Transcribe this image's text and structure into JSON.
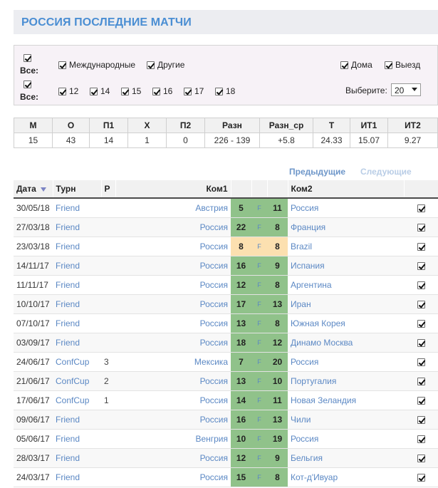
{
  "header": {
    "title": "РОССИЯ ПОСЛЕДНИЕ МАТЧИ"
  },
  "filters": {
    "all_label": "Все:",
    "type_options": [
      "Международные",
      "Другие"
    ],
    "age_options": [
      "12",
      "14",
      "15",
      "16",
      "17",
      "18"
    ],
    "venue_options": [
      "Дома",
      "Выезд"
    ],
    "select_label": "Выберите:",
    "select_value": "20"
  },
  "stats": {
    "headers": [
      "М",
      "О",
      "П1",
      "Х",
      "П2",
      "Разн",
      "Разн_ср",
      "Т",
      "ИТ1",
      "ИТ2"
    ],
    "values": [
      "15",
      "43",
      "14",
      "1",
      "0",
      "226 - 139",
      "+5.8",
      "24.33",
      "15.07",
      "9.27"
    ]
  },
  "pager": {
    "prev": "Предыдущие",
    "next": "Следующие"
  },
  "table": {
    "headers": {
      "date": "Дата",
      "tourn": "Турн",
      "round": "Р",
      "team1": "Ком1",
      "team2": "Ком2"
    },
    "rows": [
      {
        "date": "30/05/18",
        "tourn": "Friend",
        "round": "",
        "team1": "Австрия",
        "s1": "5",
        "f": "F",
        "s2": "11",
        "team2": "Россия",
        "result": "win"
      },
      {
        "date": "27/03/18",
        "tourn": "Friend",
        "round": "",
        "team1": "Россия",
        "s1": "22",
        "f": "F",
        "s2": "8",
        "team2": "Франция",
        "result": "win"
      },
      {
        "date": "23/03/18",
        "tourn": "Friend",
        "round": "",
        "team1": "Россия",
        "s1": "8",
        "f": "F",
        "s2": "8",
        "team2": "Brazil",
        "result": "draw"
      },
      {
        "date": "14/11/17",
        "tourn": "Friend",
        "round": "",
        "team1": "Россия",
        "s1": "16",
        "f": "F",
        "s2": "9",
        "team2": "Испания",
        "result": "win"
      },
      {
        "date": "11/11/17",
        "tourn": "Friend",
        "round": "",
        "team1": "Россия",
        "s1": "12",
        "f": "F",
        "s2": "8",
        "team2": "Аргентина",
        "result": "win"
      },
      {
        "date": "10/10/17",
        "tourn": "Friend",
        "round": "",
        "team1": "Россия",
        "s1": "17",
        "f": "F",
        "s2": "13",
        "team2": "Иран",
        "result": "win"
      },
      {
        "date": "07/10/17",
        "tourn": "Friend",
        "round": "",
        "team1": "Россия",
        "s1": "13",
        "f": "F",
        "s2": "8",
        "team2": "Южная Корея",
        "result": "win"
      },
      {
        "date": "03/09/17",
        "tourn": "Friend",
        "round": "",
        "team1": "Россия",
        "s1": "18",
        "f": "F",
        "s2": "12",
        "team2": "Динамо Москва",
        "result": "win"
      },
      {
        "date": "24/06/17",
        "tourn": "ConfCup",
        "round": "3",
        "team1": "Мексика",
        "s1": "7",
        "f": "F",
        "s2": "20",
        "team2": "Россия",
        "result": "win"
      },
      {
        "date": "21/06/17",
        "tourn": "ConfCup",
        "round": "2",
        "team1": "Россия",
        "s1": "13",
        "f": "F",
        "s2": "10",
        "team2": "Португалия",
        "result": "win"
      },
      {
        "date": "17/06/17",
        "tourn": "ConfCup",
        "round": "1",
        "team1": "Россия",
        "s1": "14",
        "f": "F",
        "s2": "11",
        "team2": "Новая Зеландия",
        "result": "win"
      },
      {
        "date": "09/06/17",
        "tourn": "Friend",
        "round": "",
        "team1": "Россия",
        "s1": "16",
        "f": "F",
        "s2": "13",
        "team2": "Чили",
        "result": "win"
      },
      {
        "date": "05/06/17",
        "tourn": "Friend",
        "round": "",
        "team1": "Венгрия",
        "s1": "10",
        "f": "F",
        "s2": "19",
        "team2": "Россия",
        "result": "win"
      },
      {
        "date": "28/03/17",
        "tourn": "Friend",
        "round": "",
        "team1": "Россия",
        "s1": "12",
        "f": "F",
        "s2": "9",
        "team2": "Бельгия",
        "result": "win"
      },
      {
        "date": "24/03/17",
        "tourn": "Friend",
        "round": "",
        "team1": "Россия",
        "s1": "15",
        "f": "F",
        "s2": "8",
        "team2": "Кот-д'Ивуар",
        "result": "win"
      }
    ]
  },
  "colors": {
    "accent": "#4a8ed3",
    "win": "#90c28a",
    "draw": "#fce0b0",
    "link": "#5b88c4"
  }
}
